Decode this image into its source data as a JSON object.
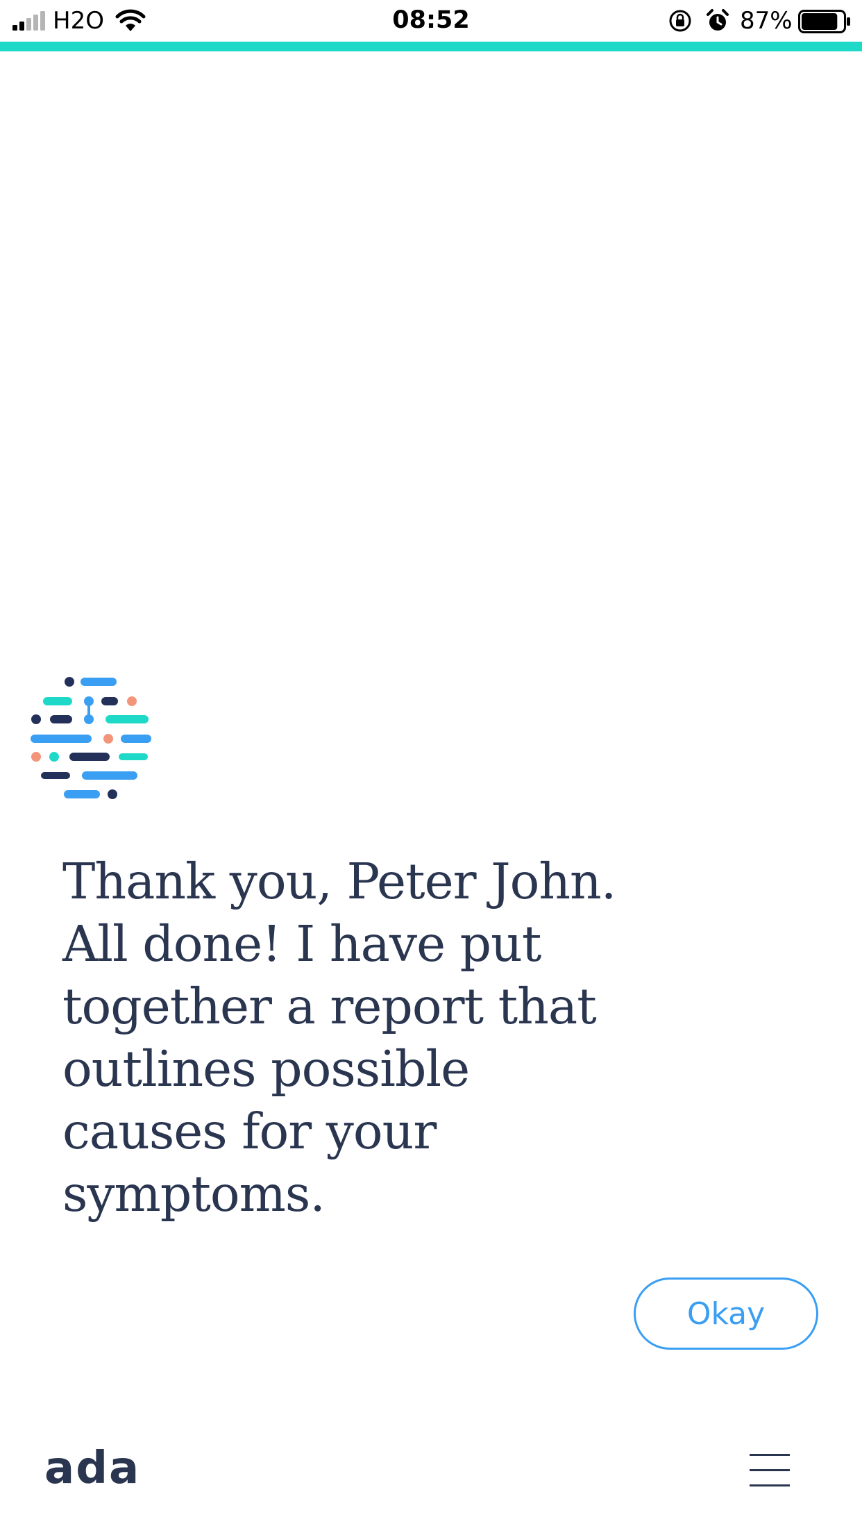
{
  "status_bar": {
    "carrier": "H2O",
    "time": "08:52",
    "battery_percent": "87%",
    "battery_level": 0.87,
    "signal_bars_filled": 2,
    "icons": [
      "signal-icon",
      "wifi-icon",
      "rotation-lock-icon",
      "alarm-icon",
      "battery-icon"
    ]
  },
  "progress": {
    "fraction": 1.0,
    "color": "#1ed9c7"
  },
  "message": {
    "text": "Thank you, Peter John. All done! I have put together a report that outlines possible causes for your symptoms."
  },
  "actions": {
    "okay_label": "Okay"
  },
  "footer": {
    "logo_text": "ada",
    "menu_icon": "hamburger-menu-icon"
  },
  "colors": {
    "text": "#2a3550",
    "accent_blue": "#3a9ef3",
    "accent_teal": "#1ed9c7",
    "accent_orange": "#f2957a",
    "navy": "#22305a"
  }
}
